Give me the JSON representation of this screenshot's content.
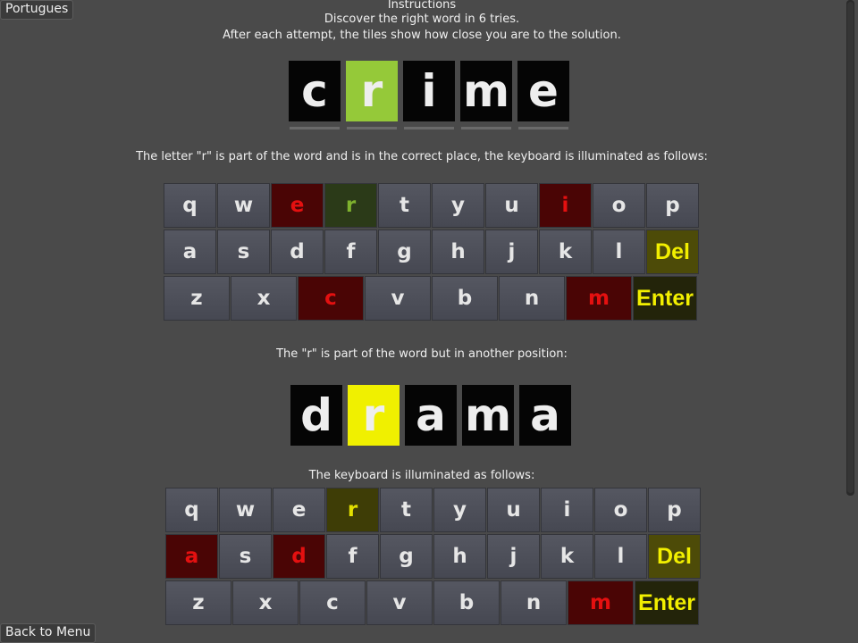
{
  "language_button": "Portugues",
  "back_button": "Back to Menu",
  "instructions": {
    "title": "Instructions",
    "line1": "Discover the right word in 6 tries.",
    "line2": "After each attempt, the tiles show how close you are to the solution."
  },
  "example1": {
    "tiles": [
      {
        "letter": "c",
        "state": "none"
      },
      {
        "letter": "r",
        "state": "correct"
      },
      {
        "letter": "i",
        "state": "none"
      },
      {
        "letter": "m",
        "state": "none"
      },
      {
        "letter": "e",
        "state": "none"
      }
    ],
    "caption": "The letter \"r\" is part of the word and is in the correct place, the keyboard is illuminated as follows:"
  },
  "keyboard1": {
    "rows": [
      [
        {
          "k": "q"
        },
        {
          "k": "w"
        },
        {
          "k": "e",
          "s": "absent"
        },
        {
          "k": "r",
          "s": "correct"
        },
        {
          "k": "t"
        },
        {
          "k": "y"
        },
        {
          "k": "u"
        },
        {
          "k": "i",
          "s": "absent"
        },
        {
          "k": "o"
        },
        {
          "k": "p"
        }
      ],
      [
        {
          "k": "a"
        },
        {
          "k": "s"
        },
        {
          "k": "d"
        },
        {
          "k": "f"
        },
        {
          "k": "g"
        },
        {
          "k": "h"
        },
        {
          "k": "j"
        },
        {
          "k": "k"
        },
        {
          "k": "l"
        },
        {
          "k": "Del",
          "s": "del"
        }
      ],
      [
        {
          "k": "z"
        },
        {
          "k": "x"
        },
        {
          "k": "c",
          "s": "absent"
        },
        {
          "k": "v"
        },
        {
          "k": "b"
        },
        {
          "k": "n"
        },
        {
          "k": "m",
          "s": "absent"
        },
        {
          "k": "Enter",
          "s": "enter"
        }
      ]
    ]
  },
  "example2": {
    "caption": "The \"r\" is part of the word but in another position:",
    "tiles": [
      {
        "letter": "d",
        "state": "none"
      },
      {
        "letter": "r",
        "state": "present"
      },
      {
        "letter": "a",
        "state": "none"
      },
      {
        "letter": "m",
        "state": "none"
      },
      {
        "letter": "a",
        "state": "none"
      }
    ],
    "caption2": "The keyboard is illuminated as follows:"
  },
  "keyboard2": {
    "rows": [
      [
        {
          "k": "q"
        },
        {
          "k": "w"
        },
        {
          "k": "e"
        },
        {
          "k": "r",
          "s": "present"
        },
        {
          "k": "t"
        },
        {
          "k": "y"
        },
        {
          "k": "u"
        },
        {
          "k": "i"
        },
        {
          "k": "o"
        },
        {
          "k": "p"
        }
      ],
      [
        {
          "k": "a",
          "s": "absent"
        },
        {
          "k": "s"
        },
        {
          "k": "d",
          "s": "absent"
        },
        {
          "k": "f"
        },
        {
          "k": "g"
        },
        {
          "k": "h"
        },
        {
          "k": "j"
        },
        {
          "k": "k"
        },
        {
          "k": "l"
        },
        {
          "k": "Del",
          "s": "del"
        }
      ],
      [
        {
          "k": "z"
        },
        {
          "k": "x"
        },
        {
          "k": "c"
        },
        {
          "k": "v"
        },
        {
          "k": "b"
        },
        {
          "k": "n"
        },
        {
          "k": "m",
          "s": "absent"
        },
        {
          "k": "Enter",
          "s": "enter"
        }
      ]
    ]
  }
}
